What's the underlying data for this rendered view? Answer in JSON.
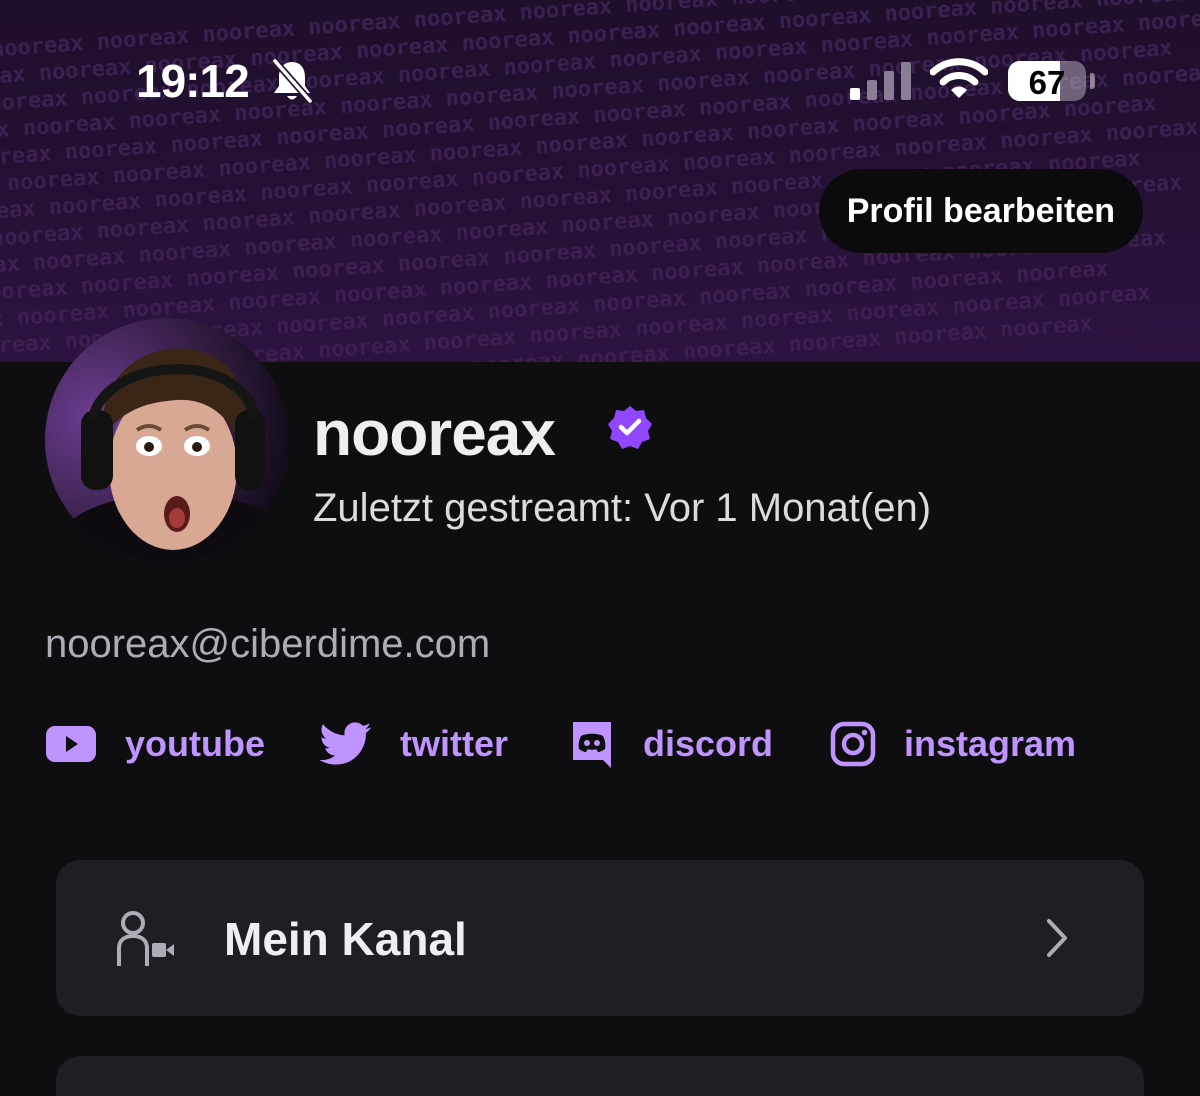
{
  "status_bar": {
    "time": "19:12",
    "battery_percent": 67,
    "battery_label": "67",
    "silent_icon": "bell-slash-icon",
    "signal_icon": "cellular-signal-icon",
    "wifi_icon": "wifi-icon"
  },
  "banner": {
    "pattern_text": "nooreax"
  },
  "header": {
    "edit_profile_label": "Profil bearbeiten"
  },
  "profile": {
    "username": "nooreax",
    "verified_icon": "verified-badge-icon",
    "last_streamed": "Zuletzt gestreamt: Vor 1 Monat(en)",
    "email": "nooreax@ciberdime.com"
  },
  "socials": [
    {
      "label": "youtube",
      "icon": "youtube-icon"
    },
    {
      "label": "twitter",
      "icon": "twitter-icon"
    },
    {
      "label": "discord",
      "icon": "discord-icon"
    },
    {
      "label": "instagram",
      "icon": "instagram-icon"
    }
  ],
  "menu": {
    "items": [
      {
        "label": "Mein Kanal",
        "icon": "channel-user-camera-icon"
      }
    ]
  },
  "colors": {
    "accent": "#bf94ff",
    "verified": "#9147ff",
    "background": "#0e0e10",
    "card": "#1f1f23",
    "banner": "#231033"
  }
}
